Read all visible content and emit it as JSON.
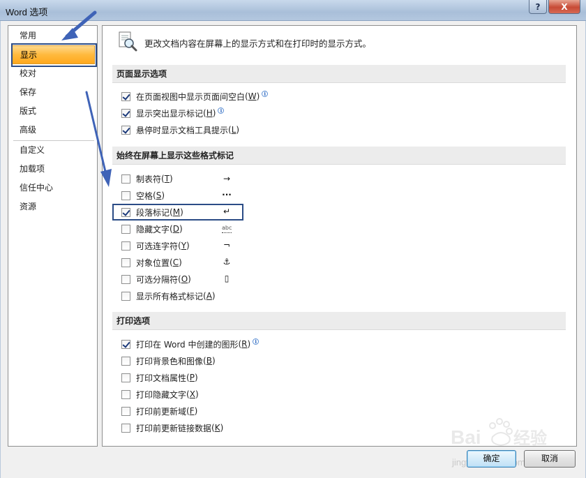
{
  "window": {
    "title": "Word 选项",
    "help_label": "?",
    "close_label": "X"
  },
  "nav": {
    "items": [
      {
        "label": "常用"
      },
      {
        "label": "显示"
      },
      {
        "label": "校对"
      },
      {
        "label": "保存"
      },
      {
        "label": "版式"
      },
      {
        "label": "高级"
      },
      {
        "label": "自定义"
      },
      {
        "label": "加载项"
      },
      {
        "label": "信任中心"
      },
      {
        "label": "资源"
      }
    ],
    "selected": "显示"
  },
  "header": {
    "text": "更改文档内容在屏幕上的显示方式和在打印时的显示方式。"
  },
  "sections": {
    "page_display": {
      "title": "页面显示选项",
      "options": [
        {
          "label": "在页面视图中显示页面间空白",
          "key": "W",
          "checked": true
        },
        {
          "label": "显示突出显示标记",
          "key": "H",
          "checked": true
        },
        {
          "label": "悬停时显示文档工具提示",
          "key": "L",
          "checked": true
        }
      ]
    },
    "formatting_marks": {
      "title": "始终在屏幕上显示这些格式标记",
      "options": [
        {
          "label": "制表符",
          "key": "T",
          "checked": false,
          "glyph": "→"
        },
        {
          "label": "空格",
          "key": "S",
          "checked": false,
          "glyph": "···"
        },
        {
          "label": "段落标记",
          "key": "M",
          "checked": true,
          "glyph": "↵"
        },
        {
          "label": "隐藏文字",
          "key": "D",
          "checked": false,
          "glyph": "abc"
        },
        {
          "label": "可选连字符",
          "key": "Y",
          "checked": false,
          "glyph": "¬"
        },
        {
          "label": "对象位置",
          "key": "C",
          "checked": false,
          "glyph": "⚓"
        },
        {
          "label": "可选分隔符",
          "key": "O",
          "checked": false,
          "glyph": "▯"
        },
        {
          "label": "显示所有格式标记",
          "key": "A",
          "checked": false
        }
      ]
    },
    "print": {
      "title": "打印选项",
      "options": [
        {
          "label": "打印在 Word 中创建的图形",
          "key": "R",
          "checked": true
        },
        {
          "label": "打印背景色和图像",
          "key": "B",
          "checked": false
        },
        {
          "label": "打印文档属性",
          "key": "P",
          "checked": false
        },
        {
          "label": "打印隐藏文字",
          "key": "X",
          "checked": false
        },
        {
          "label": "打印前更新域",
          "key": "F",
          "checked": false
        },
        {
          "label": "打印前更新链接数据",
          "key": "K",
          "checked": false
        }
      ]
    }
  },
  "buttons": {
    "ok": "确定",
    "cancel": "取消"
  },
  "watermark": {
    "text": "jingyan.baidu.com"
  },
  "colors": {
    "selected_nav": "#ffb93d",
    "annotation_blue": "#3f63b7"
  }
}
